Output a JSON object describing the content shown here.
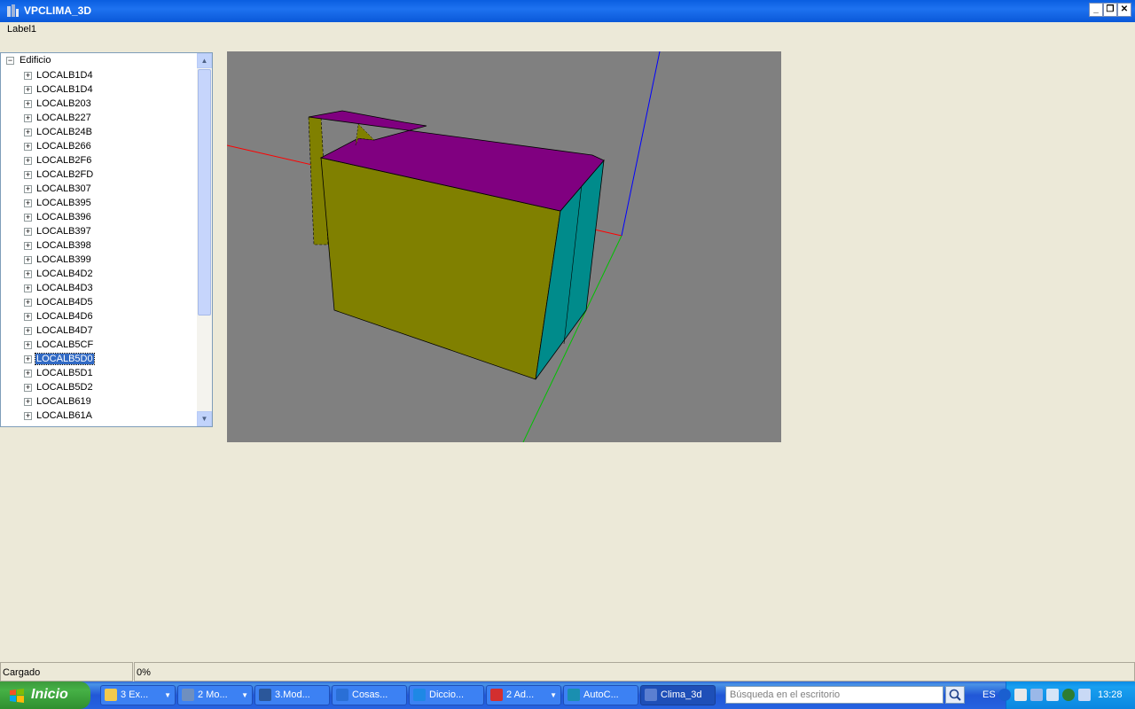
{
  "window": {
    "title": "VPCLIMA_3D"
  },
  "label1": "Label1",
  "tree": {
    "root_label": "Edificio",
    "items": [
      "LOCALB1D4",
      "LOCALB1D4",
      "LOCALB203",
      "LOCALB227",
      "LOCALB24B",
      "LOCALB266",
      "LOCALB2F6",
      "LOCALB2FD",
      "LOCALB307",
      "LOCALB395",
      "LOCALB396",
      "LOCALB397",
      "LOCALB398",
      "LOCALB399",
      "LOCALB4D2",
      "LOCALB4D3",
      "LOCALB4D5",
      "LOCALB4D6",
      "LOCALB4D7",
      "LOCALB5CF",
      "LOCALB5D0",
      "LOCALB5D1",
      "LOCALB5D2",
      "LOCALB619",
      "LOCALB61A"
    ],
    "selected_index": 20
  },
  "viewport": {
    "background": "#808080",
    "colors": {
      "top": "#800080",
      "front": "#808000",
      "side": "#008b8b"
    }
  },
  "status": {
    "left": "Cargado",
    "right": "0%"
  },
  "taskbar": {
    "start_label": "Inicio",
    "tasks": [
      {
        "label": "3 Ex...",
        "icon_color": "#f2c94c",
        "dropdown": true
      },
      {
        "label": "2 Mo...",
        "icon_color": "#6f8fbf",
        "dropdown": true
      },
      {
        "label": "3.Mod...",
        "icon_color": "#2b579a",
        "dropdown": false
      },
      {
        "label": "Cosas...",
        "icon_color": "#2a6fd6",
        "dropdown": false
      },
      {
        "label": "Diccio...",
        "icon_color": "#1e88e5",
        "dropdown": false
      },
      {
        "label": "2 Ad...",
        "icon_color": "#d32f2f",
        "dropdown": true
      },
      {
        "label": "AutoC...",
        "icon_color": "#1a8fb0",
        "dropdown": false
      },
      {
        "label": "Clima_3d",
        "icon_color": "#5b7fd1",
        "dropdown": false,
        "active": true
      }
    ],
    "search_placeholder": "Búsqueda en el escritorio",
    "language": "ES",
    "clock": "13:28"
  }
}
